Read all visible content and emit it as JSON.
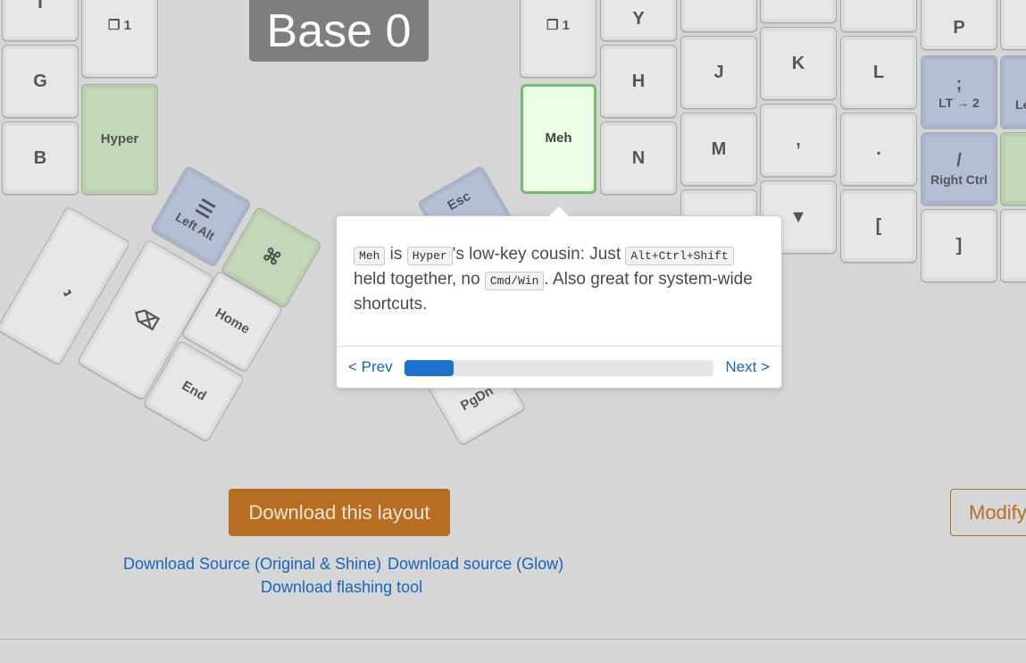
{
  "layer_title": "Base 0",
  "keys": {
    "top_left_1": "T",
    "top_left_2_icon": "❐",
    "top_left_2": "1",
    "g": "G",
    "hyper": "Hyper",
    "b": "B",
    "right_top_1_icon": "❐",
    "right_top_1": "1",
    "y": "Y",
    "h": "H",
    "meh": "Meh",
    "n": "N",
    "j": "J",
    "k": "K",
    "l": "L",
    "m": "M",
    "comma": ",",
    "period": ".",
    "down_arrow": "▼",
    "lbracket": "[",
    "rbracket": "]",
    "p": "P",
    "semicolon": ";",
    "semicolon_sub": "LT → 2",
    "slash": "/",
    "slash_sub": "Right Ctrl",
    "partial_right": "Le"
  },
  "thumb_left": {
    "space_icon": "⎵",
    "backspace_icon": "⌫",
    "left_alt": "Left Alt",
    "cmd_icon": "⌘",
    "home": "Home",
    "end": "End"
  },
  "thumb_right": {
    "esc": "Esc",
    "pgdn": "PgDn"
  },
  "popover": {
    "kbd_meh": "Meh",
    "text_is": " is ",
    "kbd_hyper": "Hyper",
    "text_cousin": "'s low-key cousin: Just ",
    "kbd_combo": "Alt+Ctrl+Shift",
    "text_held": " held together, no ",
    "kbd_cmd": "Cmd/Win",
    "text_end": ". Also great for system-wide shortcuts.",
    "prev_label": "< Prev",
    "next_label": "Next >",
    "progress_fraction": 0.16
  },
  "actions": {
    "download_layout": "Download this layout",
    "modify": "Modify",
    "download_source_original": "Download Source (Original & Shine)",
    "separator": "·",
    "download_source_glow": "Download source (Glow)",
    "download_flashing_tool": "Download flashing tool"
  },
  "colors": {
    "hyper_green": "#c3d8b8",
    "layer_blue": "#b4bfd6",
    "meh_highlight": "#6fbf6f",
    "download_orange": "#b86e22",
    "link_blue": "#1565c0",
    "progress_blue": "#1a73d1"
  }
}
